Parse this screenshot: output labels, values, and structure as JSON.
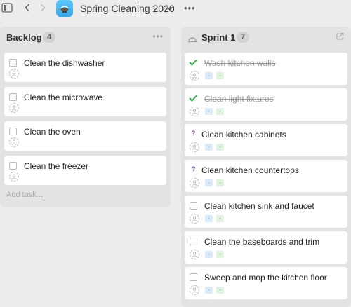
{
  "header": {
    "project_title": "Spring Cleaning 2020",
    "more_label": "•••"
  },
  "backlog": {
    "title": "Backlog",
    "count": "4",
    "more_label": "•••",
    "add_task_label": "Add task...",
    "cards": [
      {
        "title": "Clean the dishwasher"
      },
      {
        "title": "Clean the microwave"
      },
      {
        "title": "Clean the oven"
      },
      {
        "title": "Clean the freezer"
      }
    ]
  },
  "sprint": {
    "title": "Sprint 1",
    "count": "7",
    "tag_text": "-",
    "cards": [
      {
        "title": "Wash kitchen walls",
        "status": "done"
      },
      {
        "title": "Clean light fixtures",
        "status": "done"
      },
      {
        "title": "Clean kitchen cabinets",
        "status": "question"
      },
      {
        "title": "Clean kitchen countertops",
        "status": "question"
      },
      {
        "title": "Clean kitchen sink and faucet",
        "status": "todo"
      },
      {
        "title": "Clean the baseboards and trim",
        "status": "todo"
      },
      {
        "title": "Sweep and mop the kitchen floor",
        "status": "todo"
      }
    ]
  },
  "colors": {
    "check": "#2db84d",
    "question": "#8a3fd0",
    "tag_blue": "#dbeaf8",
    "tag_green": "#dff3df",
    "app_icon": "#3aa6ea"
  }
}
